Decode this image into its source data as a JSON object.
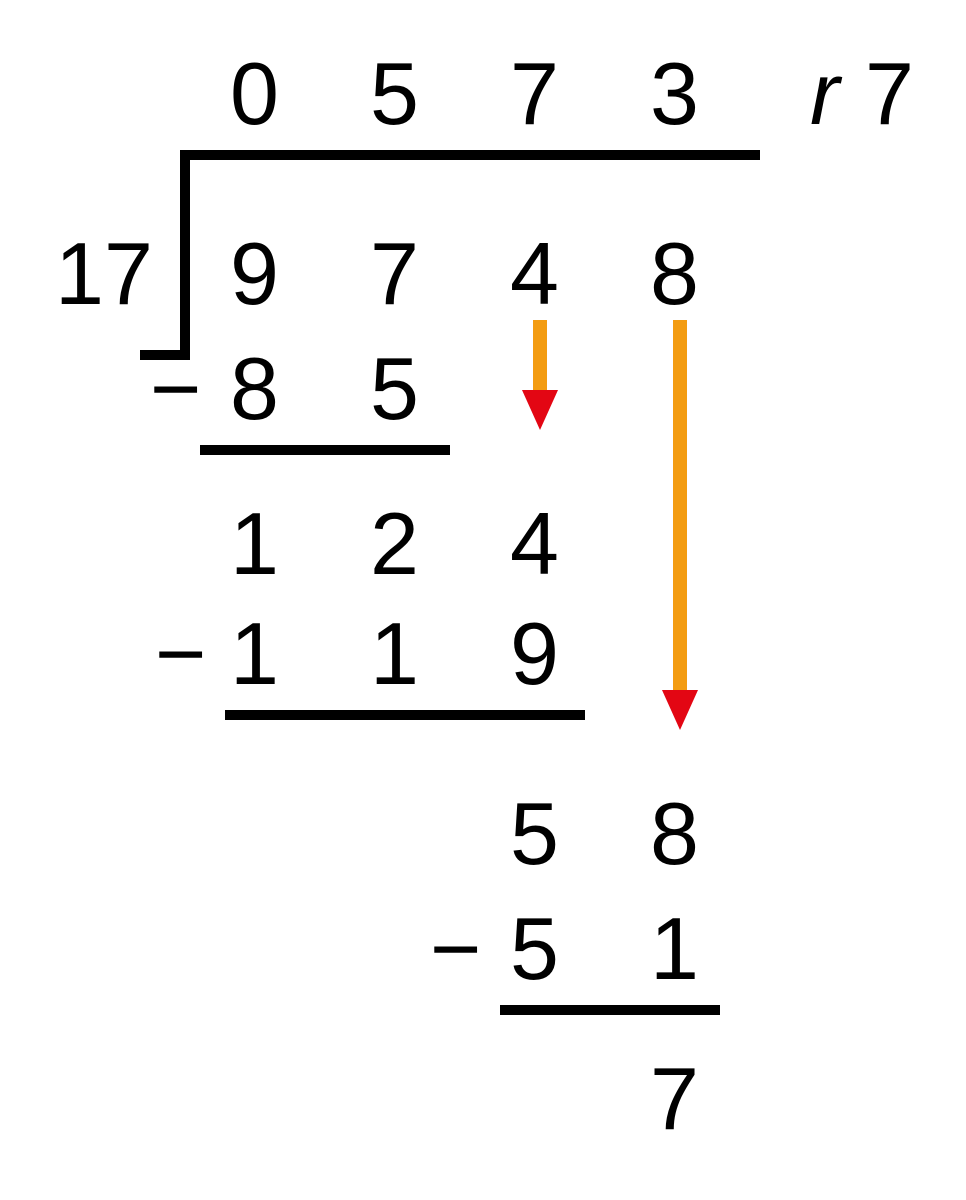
{
  "divisor": "17",
  "quotient": {
    "d0": "0",
    "d1": "5",
    "d2": "7",
    "d3": "3"
  },
  "remainder_label": "r",
  "remainder_value": "7",
  "dividend": {
    "d0": "9",
    "d1": "7",
    "d2": "4",
    "d3": "8"
  },
  "step1": {
    "minus": "−",
    "d0": "8",
    "d1": "5"
  },
  "line1_diff": {
    "d0": "1",
    "d1": "2",
    "d2": "4"
  },
  "step2": {
    "minus": "−",
    "d0": "1",
    "d1": "1",
    "d2": "9"
  },
  "line2_diff": {
    "d0": "5",
    "d1": "8"
  },
  "step3": {
    "minus": "−",
    "d0": "5",
    "d1": "1"
  },
  "final": {
    "d0": "7"
  },
  "colors": {
    "arrow_stroke": "#f39c12",
    "arrow_head": "#e30613"
  },
  "chart_data": {
    "type": "table",
    "operation": "long_division",
    "divisor": 17,
    "dividend": 9748,
    "quotient": 573,
    "remainder": 7,
    "quotient_digits": [
      0,
      5,
      7,
      3
    ],
    "steps": [
      {
        "partial": 97,
        "multiply": 85,
        "difference": 12,
        "bring_down": 4
      },
      {
        "partial": 124,
        "multiply": 119,
        "difference": 5,
        "bring_down": 8
      },
      {
        "partial": 58,
        "multiply": 51,
        "difference": 7
      }
    ]
  }
}
